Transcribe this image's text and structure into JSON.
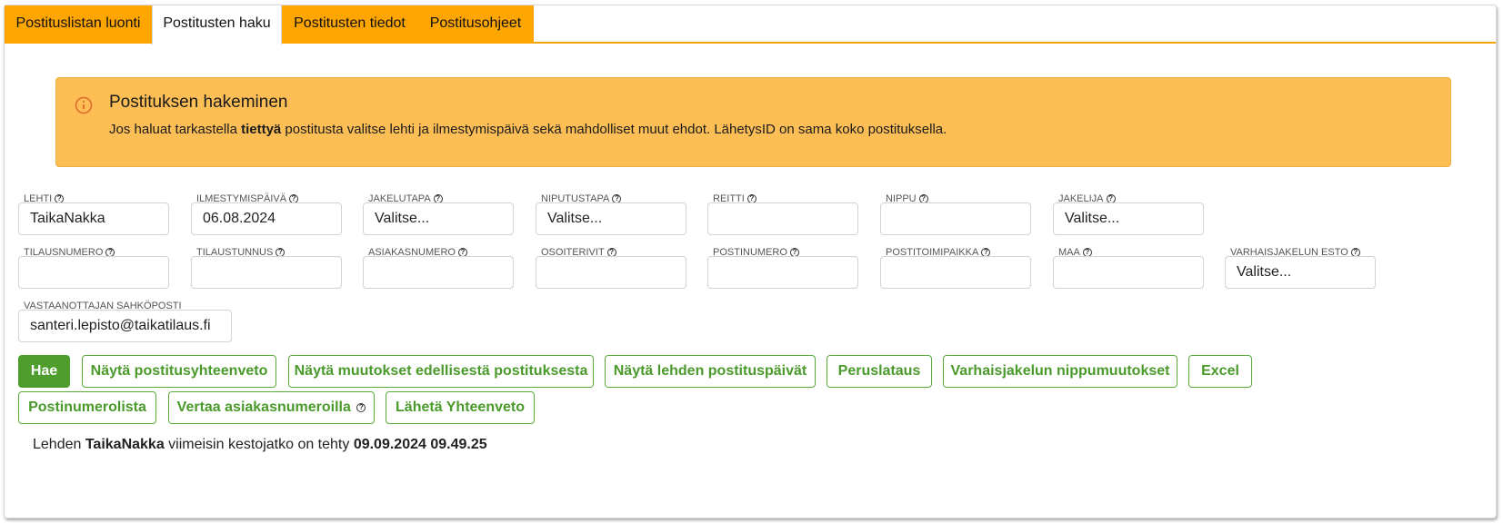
{
  "tabs": [
    {
      "label": "Postituslistan luonti",
      "active": false
    },
    {
      "label": "Postitusten haku",
      "active": true
    },
    {
      "label": "Postitusten tiedot",
      "active": false
    },
    {
      "label": "Postitusohjeet",
      "active": false
    }
  ],
  "info": {
    "icon": "info-circle-icon",
    "title": "Postituksen hakeminen",
    "text_before": "Jos haluat tarkastella ",
    "text_bold": "tiettyä",
    "text_after": " postitusta valitse lehti ja ilmestymispäivä sekä mahdolliset muut ehdot. LähetysID on sama koko postituksella."
  },
  "fields": {
    "lehti": {
      "label": "LEHTI",
      "value": "TaikaNakka"
    },
    "ilmestymispaiva": {
      "label": "ILMESTYMISPÄIVÄ",
      "value": "06.08.2024"
    },
    "jakelutapa": {
      "label": "JAKELUTAPA",
      "value": "Valitse..."
    },
    "niputustapa": {
      "label": "NIPUTUSTAPA",
      "value": "Valitse..."
    },
    "reitti": {
      "label": "REITTI",
      "value": ""
    },
    "nippu": {
      "label": "NIPPU",
      "value": ""
    },
    "jakelija": {
      "label": "JAKELIJA",
      "value": "Valitse..."
    },
    "tilausnumero": {
      "label": "TILAUSNUMERO",
      "value": ""
    },
    "tilaustunnus": {
      "label": "TILAUSTUNNUS",
      "value": ""
    },
    "asiakasnumero": {
      "label": "ASIAKASNUMERO",
      "value": ""
    },
    "osoiterivit": {
      "label": "OSOITERIVIT",
      "value": ""
    },
    "postinumero": {
      "label": "POSTINUMERO",
      "value": ""
    },
    "postitoimipaikka": {
      "label": "POSTITOIMIPAIKKA",
      "value": ""
    },
    "maa": {
      "label": "MAA",
      "value": ""
    },
    "varhaisjakelun_esto": {
      "label": "VARHAISJAKELUN ESTO",
      "value": "Valitse..."
    },
    "sahkoposti": {
      "label": "VASTAANOTTAJAN SAHKÖPOSTI",
      "value": "santeri.lepisto@taikatilaus.fi"
    }
  },
  "buttons": {
    "hae": "Hae",
    "yhteenveto": "Näytä postitusyhteenveto",
    "muutokset": "Näytä muutokset edellisestä postituksesta",
    "postituspaivat": "Näytä lehden postituspäivät",
    "peruslataus": "Peruslataus",
    "nippumuutokset": "Varhaisjakelun nippumuutokset",
    "excel": "Excel",
    "postinumerolista": "Postinumerolista",
    "vertaa": "Vertaa asiakasnumeroilla",
    "laheta": "Lähetä Yhteenveto"
  },
  "status": {
    "prefix": "Lehden ",
    "paper": "TaikaNakka",
    "middle": " viimeisin kestojatko on tehty ",
    "datetime": "09.09.2024 09.49.25"
  },
  "colors": {
    "tab_orange": "#ffa500",
    "info_bg": "#fdbf55",
    "green": "#4f9e2d"
  }
}
